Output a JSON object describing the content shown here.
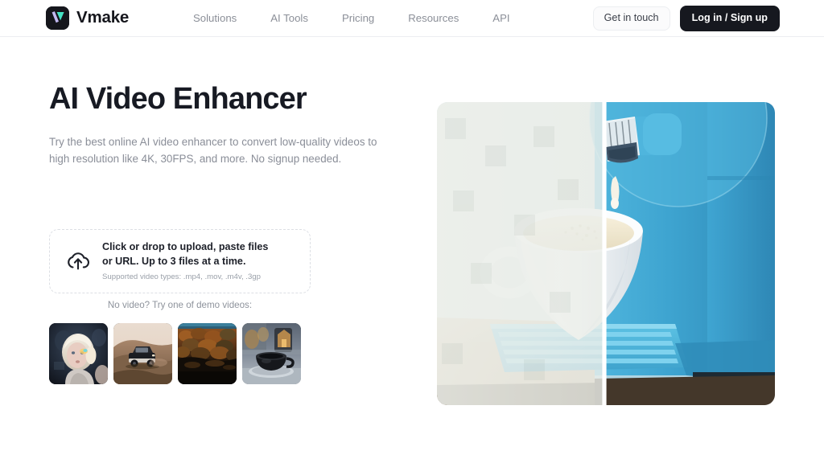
{
  "header": {
    "brand": {
      "name": "Vmake",
      "icon": "vmake-logo-icon"
    },
    "nav": [
      {
        "label": "Solutions"
      },
      {
        "label": "AI Tools"
      },
      {
        "label": "Pricing"
      },
      {
        "label": "Resources"
      },
      {
        "label": "API"
      }
    ],
    "actions": {
      "contact_label": "Get in touch",
      "auth_label": "Log in / Sign up"
    }
  },
  "hero": {
    "title": "AI Video Enhancer",
    "subtitle": "Try the best online AI video enhancer to convert low-quality videos to high resolution like 4K, 30FPS, and more. No signup needed.",
    "comparison_image": {
      "alt": "Before and after comparison of a blue coffee machine dispensing milk into a white cup",
      "left_state": "low-quality",
      "right_state": "enhanced"
    }
  },
  "upload": {
    "icon": "cloud-upload-icon",
    "headline": "Click or drop to upload, paste files or URL. Up to 3 files at a time.",
    "supported_types": "Supported video types: .mp4, .mov, .m4v, .3gp"
  },
  "demo": {
    "label": "No video? Try one of demo videos:",
    "items": [
      {
        "name": "demo-portrait-child",
        "alt": "Portrait of a child with light hair on a dark background"
      },
      {
        "name": "demo-desert-car",
        "alt": "SUV driving over desert sand dunes"
      },
      {
        "name": "demo-autumn-landscape",
        "alt": "Autumn forest landscape over dark water"
      },
      {
        "name": "demo-coffee-cup",
        "alt": "Dark coffee cup and saucer with warm bokeh background"
      }
    ]
  },
  "colors": {
    "text_dark": "#171a23",
    "text_muted": "#8a8e98",
    "button_dark": "#16181f",
    "border_light": "#eceef1",
    "logo_teal": "#45e3c4",
    "logo_lavender": "#c3b9f2",
    "machine_blue": "#3fa9d4"
  }
}
